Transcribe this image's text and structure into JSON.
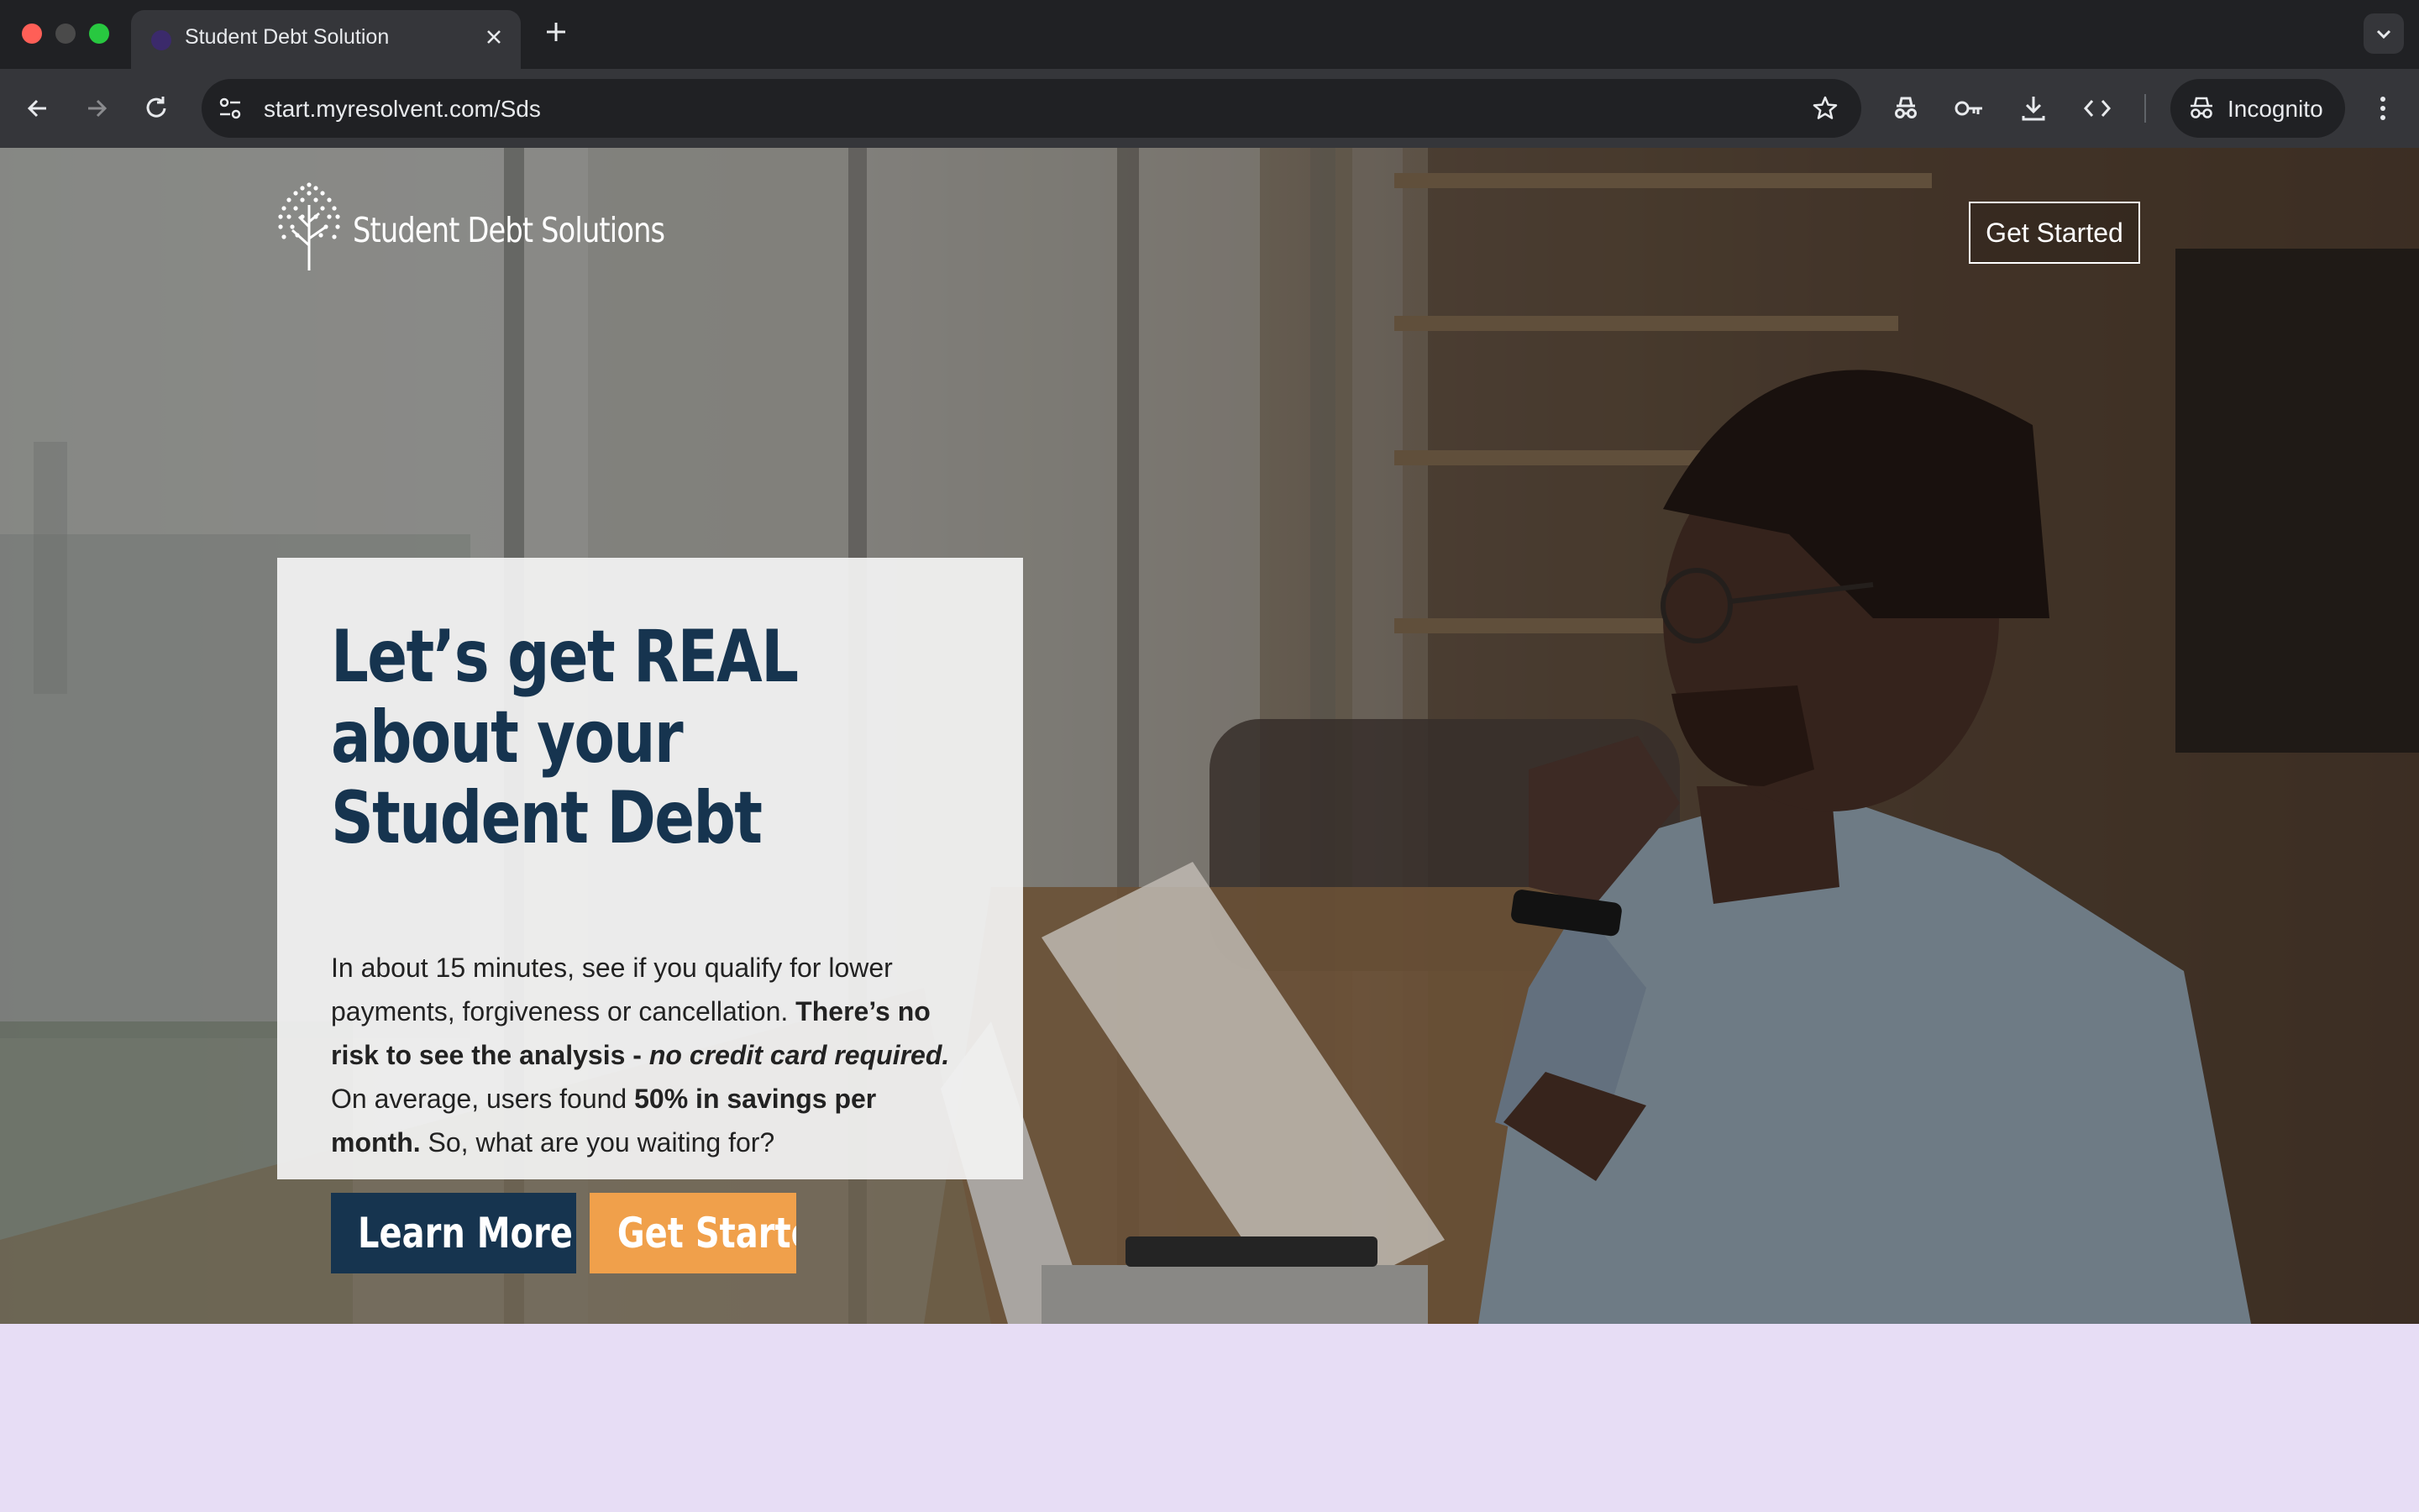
{
  "browser": {
    "tab": {
      "title": "Student Debt Solution"
    },
    "address_bar": {
      "url": "start.myresolvent.com/Sds"
    },
    "profile_label": "Incognito",
    "icons": [
      "back-icon",
      "forward-icon",
      "reload-icon",
      "site-info-icon",
      "star-icon",
      "incognito-icon",
      "password-key-icon",
      "download-icon",
      "devtools-icon",
      "menu-icon"
    ]
  },
  "header": {
    "logo_text": "Student Debt Solutions",
    "cta_label": "Get Started"
  },
  "hero": {
    "title": "Let’s get REAL about your Student Debt",
    "body": {
      "part1": "In about 15 minutes, see if you qualify for lower payments, forgiveness or cancellation. ",
      "bold1": "There’s no risk to see the analysis - ",
      "bold_italic": "no credit card required.",
      "part2": " On average, users found ",
      "bold2": "50% in savings per month.",
      "part3": " So, what are you waiting for?"
    },
    "learn_more_label": "Learn More",
    "get_started_label": "Get Started"
  },
  "colors": {
    "navy": "#16344f",
    "orange": "#f0a04b",
    "lavender": "#e7ddf5"
  }
}
